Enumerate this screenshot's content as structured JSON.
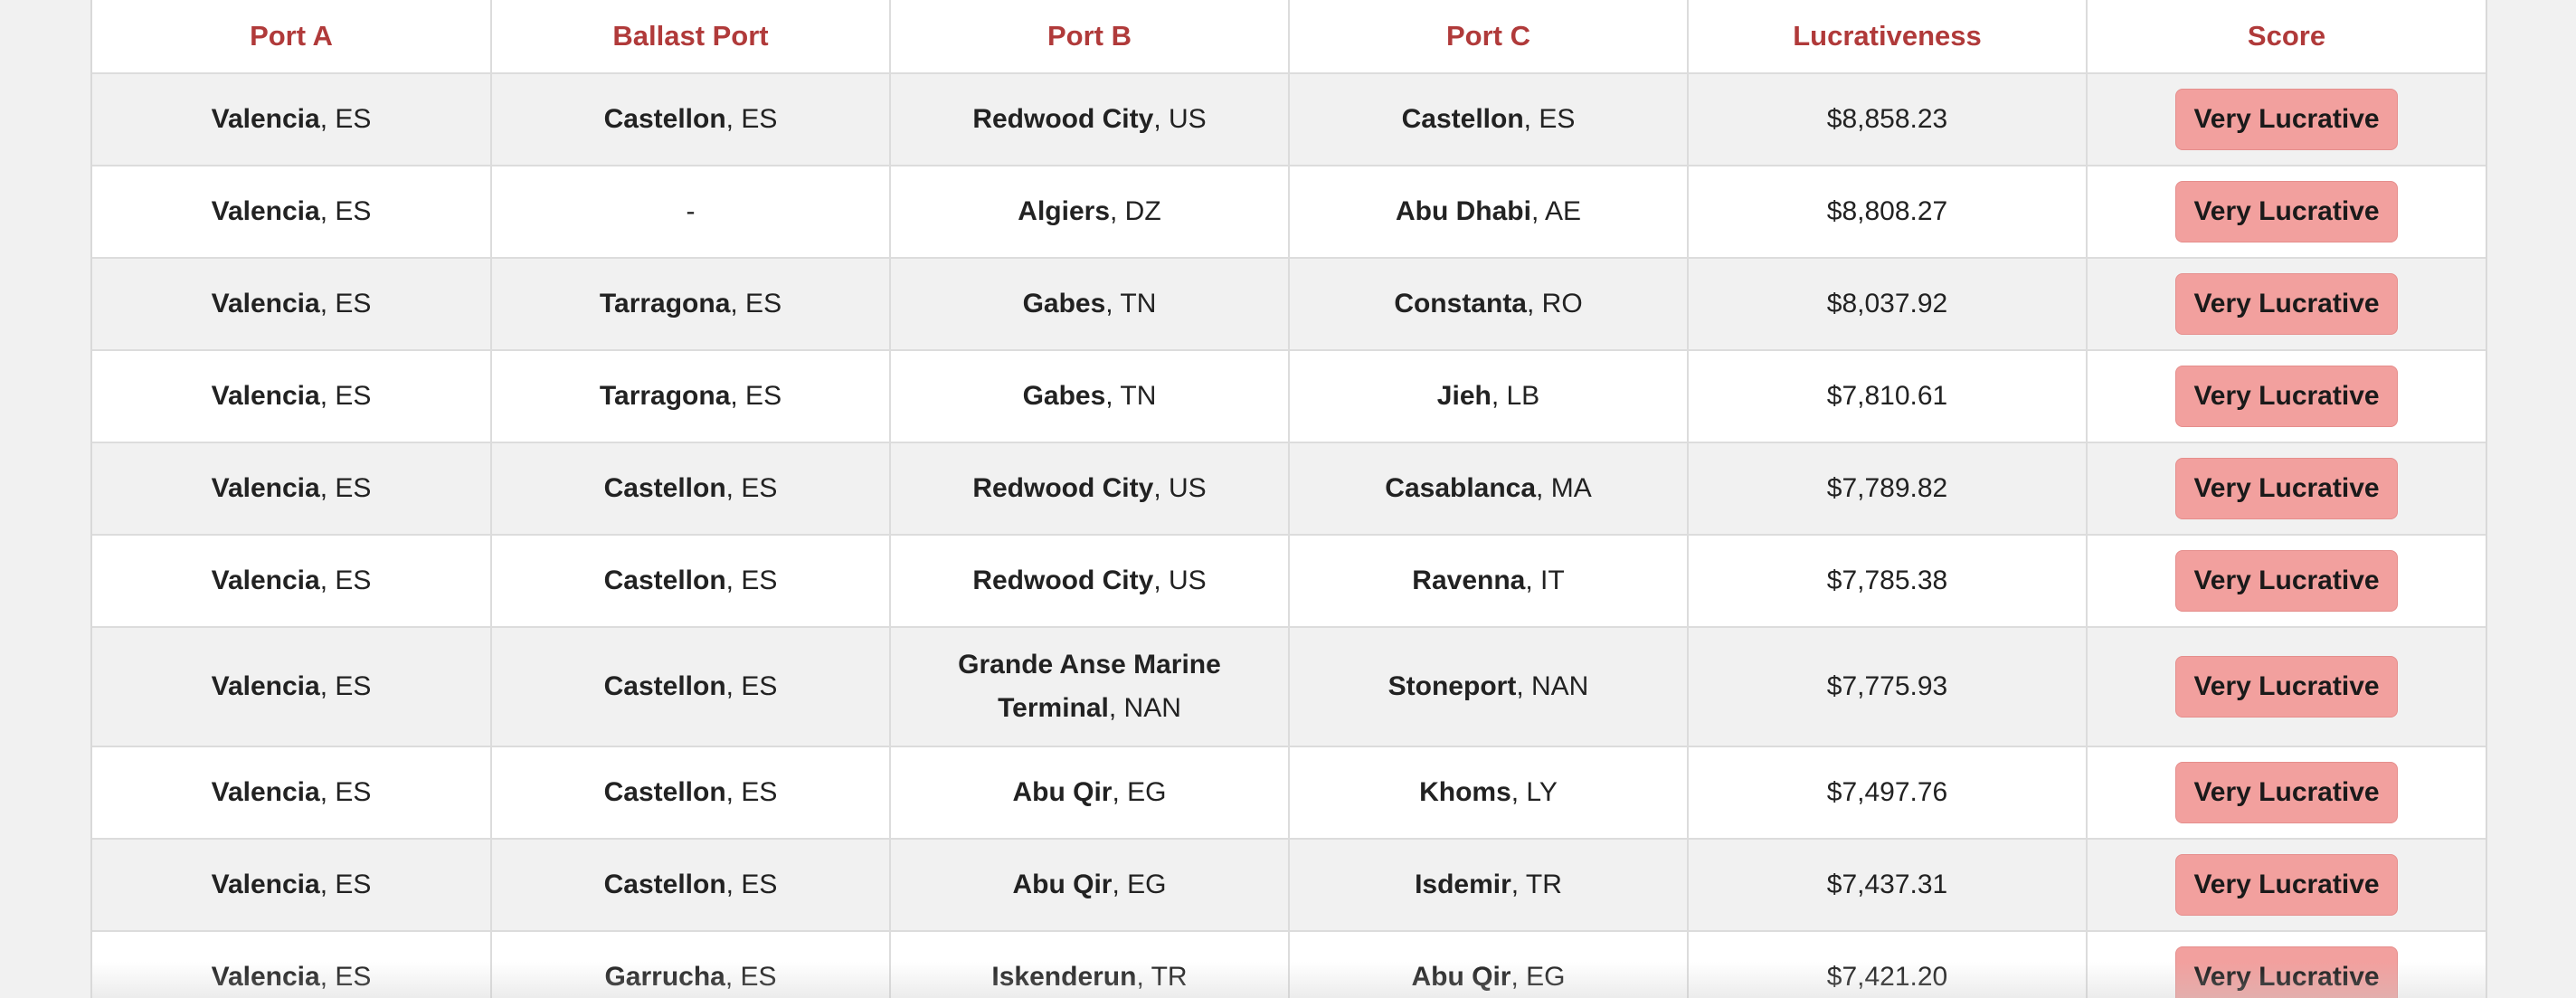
{
  "table": {
    "headers": [
      "Port A",
      "Ballast Port",
      "Port B",
      "Port C",
      "Lucrativeness",
      "Score"
    ],
    "rows": [
      {
        "port_a": {
          "city": "Valencia",
          "country": ", ES"
        },
        "ballast": {
          "city": "Castellon",
          "country": ", ES"
        },
        "port_b": {
          "city": "Redwood City",
          "country": ", US"
        },
        "port_c": {
          "city": "Castellon",
          "country": ", ES"
        },
        "lucrativeness": "$8,858.23",
        "score": "Very Lucrative"
      },
      {
        "port_a": {
          "city": "Valencia",
          "country": ", ES"
        },
        "ballast": {
          "city": "",
          "country": "-"
        },
        "port_b": {
          "city": "Algiers",
          "country": ", DZ"
        },
        "port_c": {
          "city": "Abu Dhabi",
          "country": ", AE"
        },
        "lucrativeness": "$8,808.27",
        "score": "Very Lucrative"
      },
      {
        "port_a": {
          "city": "Valencia",
          "country": ", ES"
        },
        "ballast": {
          "city": "Tarragona",
          "country": ", ES"
        },
        "port_b": {
          "city": "Gabes",
          "country": ", TN"
        },
        "port_c": {
          "city": "Constanta",
          "country": ", RO"
        },
        "lucrativeness": "$8,037.92",
        "score": "Very Lucrative"
      },
      {
        "port_a": {
          "city": "Valencia",
          "country": ", ES"
        },
        "ballast": {
          "city": "Tarragona",
          "country": ", ES"
        },
        "port_b": {
          "city": "Gabes",
          "country": ", TN"
        },
        "port_c": {
          "city": "Jieh",
          "country": ", LB"
        },
        "lucrativeness": "$7,810.61",
        "score": "Very Lucrative"
      },
      {
        "port_a": {
          "city": "Valencia",
          "country": ", ES"
        },
        "ballast": {
          "city": "Castellon",
          "country": ", ES"
        },
        "port_b": {
          "city": "Redwood City",
          "country": ", US"
        },
        "port_c": {
          "city": "Casablanca",
          "country": ", MA"
        },
        "lucrativeness": "$7,789.82",
        "score": "Very Lucrative"
      },
      {
        "port_a": {
          "city": "Valencia",
          "country": ", ES"
        },
        "ballast": {
          "city": "Castellon",
          "country": ", ES"
        },
        "port_b": {
          "city": "Redwood City",
          "country": ", US"
        },
        "port_c": {
          "city": "Ravenna",
          "country": ", IT"
        },
        "lucrativeness": "$7,785.38",
        "score": "Very Lucrative"
      },
      {
        "port_a": {
          "city": "Valencia",
          "country": ", ES"
        },
        "ballast": {
          "city": "Castellon",
          "country": ", ES"
        },
        "port_b": {
          "city": "Grande Anse Marine Terminal",
          "country": ", NAN"
        },
        "port_c": {
          "city": "Stoneport",
          "country": ", NAN"
        },
        "lucrativeness": "$7,775.93",
        "score": "Very Lucrative"
      },
      {
        "port_a": {
          "city": "Valencia",
          "country": ", ES"
        },
        "ballast": {
          "city": "Castellon",
          "country": ", ES"
        },
        "port_b": {
          "city": "Abu Qir",
          "country": ", EG"
        },
        "port_c": {
          "city": "Khoms",
          "country": ", LY"
        },
        "lucrativeness": "$7,497.76",
        "score": "Very Lucrative"
      },
      {
        "port_a": {
          "city": "Valencia",
          "country": ", ES"
        },
        "ballast": {
          "city": "Castellon",
          "country": ", ES"
        },
        "port_b": {
          "city": "Abu Qir",
          "country": ", EG"
        },
        "port_c": {
          "city": "Isdemir",
          "country": ", TR"
        },
        "lucrativeness": "$7,437.31",
        "score": "Very Lucrative"
      },
      {
        "port_a": {
          "city": "Valencia",
          "country": ", ES"
        },
        "ballast": {
          "city": "Garrucha",
          "country": ", ES"
        },
        "port_b": {
          "city": "Iskenderun",
          "country": ", TR"
        },
        "port_c": {
          "city": "Abu Qir",
          "country": ", EG"
        },
        "lucrativeness": "$7,421.20",
        "score": "Very Lucrative"
      }
    ]
  },
  "colors": {
    "header_text": "#b03a3a",
    "badge_bg": "#f2a09e",
    "row_alt": "#f1f1f1"
  }
}
